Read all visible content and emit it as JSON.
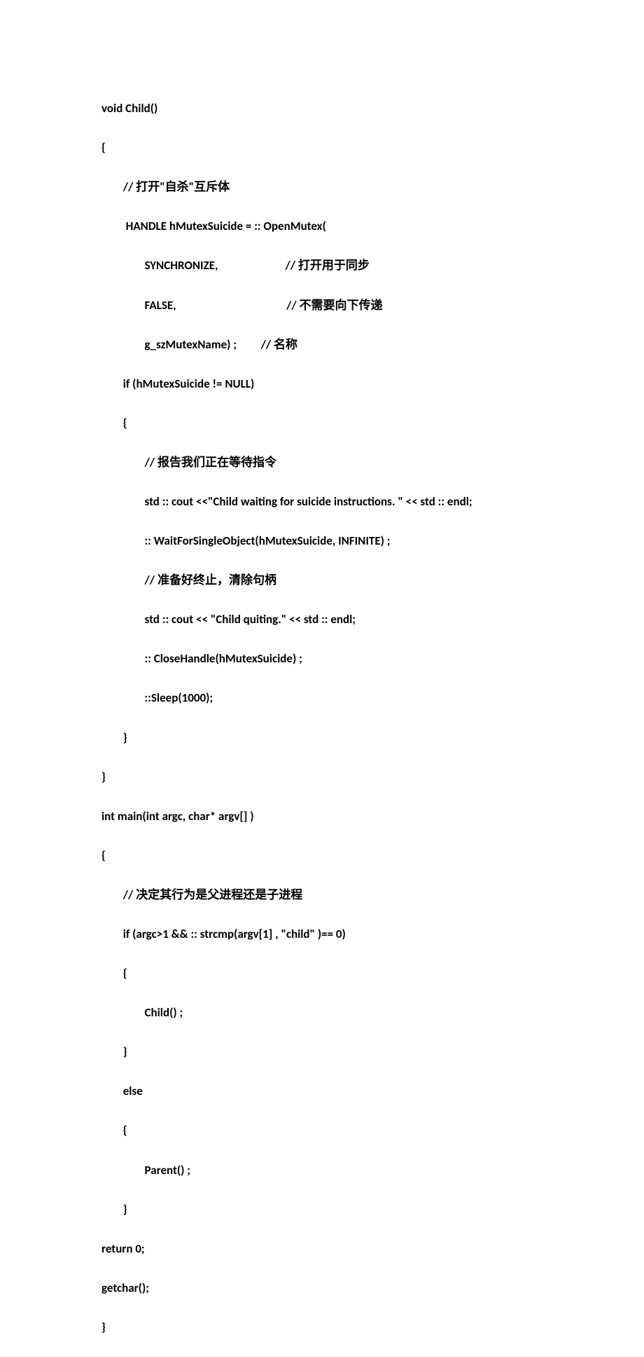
{
  "lines": [
    "void Child()",
    "{",
    "        // 打开\"自杀\"互斥体",
    "         HANDLE hMutexSuicide = :: OpenMutex(",
    "                SYNCHRONIZE,                         // 打开用于同步",
    "                FALSE,                                         // 不需要向下传递",
    "                g_szMutexName) ;         // 名称",
    "        if (hMutexSuicide != NULL)",
    "        {",
    "                // 报告我们正在等待指令",
    "                std :: cout <<\"Child waiting for suicide instructions. \" << std :: endl;",
    "                :: WaitForSingleObject(hMutexSuicide, INFINITE) ;",
    "                // 准备好终止，清除句柄",
    "                std :: cout << \"Child quiting.\" << std :: endl;",
    "                :: CloseHandle(hMutexSuicide) ;",
    "                ::Sleep(1000);",
    "        }",
    "}",
    "int main(int argc, char* argv[] )",
    "{",
    "        // 决定其行为是父进程还是子进程",
    "        if (argc>1 && :: strcmp(argv[1] , \"child\" )== 0)",
    "        {",
    "                Child() ;",
    "        }",
    "        else",
    "        {",
    "                Parent() ;",
    "        }",
    "return 0;",
    "getchar();",
    "}"
  ]
}
